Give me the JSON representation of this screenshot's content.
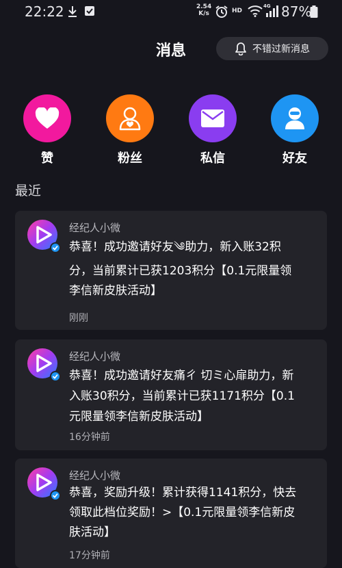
{
  "status_bar": {
    "time": "22:22",
    "speed_value": "2.54",
    "speed_unit": "K/s",
    "hd": "HD",
    "network": "4G",
    "battery": "87%"
  },
  "header": {
    "title": "消息",
    "notify_label": "不错过新消息"
  },
  "categories": [
    {
      "label": "赞",
      "icon": "heart-icon",
      "color": "#f2199e"
    },
    {
      "label": "粉丝",
      "icon": "fans-person-icon",
      "color": "#ff7a12"
    },
    {
      "label": "私信",
      "icon": "envelope-icon",
      "color": "#8a3df0"
    },
    {
      "label": "好友",
      "icon": "friend-icon",
      "color": "#1e95f3"
    }
  ],
  "recent": {
    "label": "最近",
    "messages": [
      {
        "sender": "经纪人小微",
        "lines": [
          "恭喜！成功邀请好友༄助力，新入账32积",
          "分，当前累计已获1203积分【0.1元限量领",
          "李信新皮肤活动】"
        ],
        "time": "刚刚"
      },
      {
        "sender": "经纪人小微",
        "lines": [
          "恭喜！成功邀请好友痛ㄔ 切ミ心扉助力，新",
          "入账30积分，当前累计已获1171积分【0.1",
          "元限量领李信新皮肤活动】"
        ],
        "time": "16分钟前"
      },
      {
        "sender": "经纪人小微",
        "lines": [
          "恭喜，奖励升级！累计获得1141积分，快去",
          "领取此档位奖励！>【0.1元限量领李信新皮",
          "肤活动】"
        ],
        "time": "17分钟前"
      }
    ]
  },
  "colors": {
    "background": "#16161d",
    "card": "#232329",
    "accent_pink": "#f2199e",
    "accent_orange": "#ff7a12",
    "accent_purple": "#8a3df0",
    "accent_blue": "#1e95f3"
  }
}
